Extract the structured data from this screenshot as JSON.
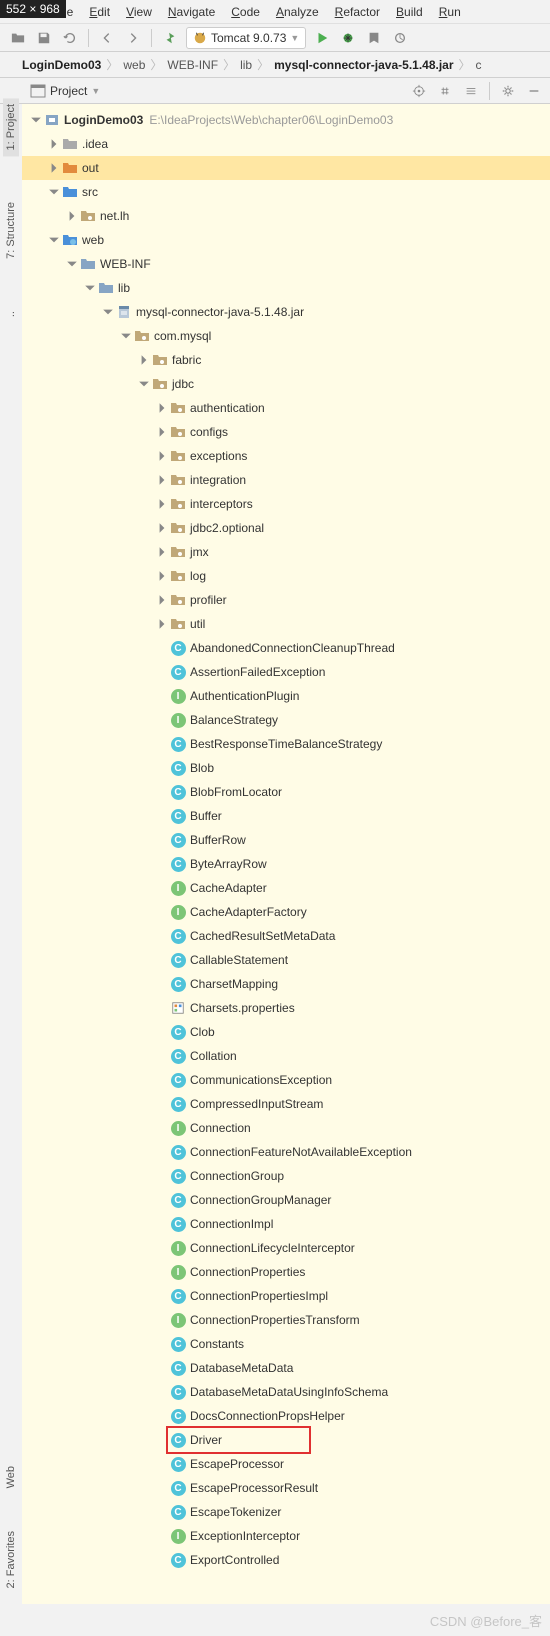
{
  "dimBadge": "552 × 968",
  "menu": [
    "File",
    "Edit",
    "View",
    "Navigate",
    "Code",
    "Analyze",
    "Refactor",
    "Build",
    "Run"
  ],
  "runConfig": "Tomcat 9.0.73",
  "breadcrumbs": [
    "LoginDemo03",
    "web",
    "WEB-INF",
    "lib",
    "mysql-connector-java-5.1.48.jar",
    "c"
  ],
  "projectLabel": "Project",
  "sideTabs": {
    "project": "1: Project",
    "structure": "7: Structure",
    "web": "Web",
    "favorites": "2: Favorites"
  },
  "tree": [
    {
      "d": 0,
      "a": "down",
      "t": "module",
      "l": "LoginDemo03",
      "p": "E:\\IdeaProjects\\Web\\chapter06\\LoginDemo03",
      "bold": true
    },
    {
      "d": 1,
      "a": "right",
      "t": "folder-grey",
      "l": ".idea"
    },
    {
      "d": 1,
      "a": "right",
      "t": "folder-orange",
      "l": "out",
      "sel": true
    },
    {
      "d": 1,
      "a": "down",
      "t": "folder-blue",
      "l": "src"
    },
    {
      "d": 2,
      "a": "right",
      "t": "pkg",
      "l": "net.lh"
    },
    {
      "d": 1,
      "a": "down",
      "t": "web",
      "l": "web"
    },
    {
      "d": 2,
      "a": "down",
      "t": "folder",
      "l": "WEB-INF"
    },
    {
      "d": 3,
      "a": "down",
      "t": "folder",
      "l": "lib"
    },
    {
      "d": 4,
      "a": "down",
      "t": "jar",
      "l": "mysql-connector-java-5.1.48.jar"
    },
    {
      "d": 5,
      "a": "down",
      "t": "pkg",
      "l": "com.mysql"
    },
    {
      "d": 6,
      "a": "right",
      "t": "pkg",
      "l": "fabric"
    },
    {
      "d": 6,
      "a": "down",
      "t": "pkg",
      "l": "jdbc"
    },
    {
      "d": 7,
      "a": "right",
      "t": "pkg",
      "l": "authentication"
    },
    {
      "d": 7,
      "a": "right",
      "t": "pkg",
      "l": "configs"
    },
    {
      "d": 7,
      "a": "right",
      "t": "pkg",
      "l": "exceptions"
    },
    {
      "d": 7,
      "a": "right",
      "t": "pkg",
      "l": "integration"
    },
    {
      "d": 7,
      "a": "right",
      "t": "pkg",
      "l": "interceptors"
    },
    {
      "d": 7,
      "a": "right",
      "t": "pkg",
      "l": "jdbc2.optional"
    },
    {
      "d": 7,
      "a": "right",
      "t": "pkg",
      "l": "jmx"
    },
    {
      "d": 7,
      "a": "right",
      "t": "pkg",
      "l": "log"
    },
    {
      "d": 7,
      "a": "right",
      "t": "pkg",
      "l": "profiler"
    },
    {
      "d": 7,
      "a": "right",
      "t": "pkg",
      "l": "util"
    },
    {
      "d": 7,
      "a": "",
      "t": "class",
      "l": "AbandonedConnectionCleanupThread"
    },
    {
      "d": 7,
      "a": "",
      "t": "class",
      "l": "AssertionFailedException"
    },
    {
      "d": 7,
      "a": "",
      "t": "intf",
      "l": "AuthenticationPlugin"
    },
    {
      "d": 7,
      "a": "",
      "t": "intf",
      "l": "BalanceStrategy"
    },
    {
      "d": 7,
      "a": "",
      "t": "class",
      "l": "BestResponseTimeBalanceStrategy"
    },
    {
      "d": 7,
      "a": "",
      "t": "class",
      "l": "Blob"
    },
    {
      "d": 7,
      "a": "",
      "t": "class",
      "l": "BlobFromLocator"
    },
    {
      "d": 7,
      "a": "",
      "t": "class",
      "l": "Buffer"
    },
    {
      "d": 7,
      "a": "",
      "t": "class",
      "l": "BufferRow"
    },
    {
      "d": 7,
      "a": "",
      "t": "class",
      "l": "ByteArrayRow"
    },
    {
      "d": 7,
      "a": "",
      "t": "intf",
      "l": "CacheAdapter"
    },
    {
      "d": 7,
      "a": "",
      "t": "intf",
      "l": "CacheAdapterFactory"
    },
    {
      "d": 7,
      "a": "",
      "t": "class",
      "l": "CachedResultSetMetaData"
    },
    {
      "d": 7,
      "a": "",
      "t": "class",
      "l": "CallableStatement"
    },
    {
      "d": 7,
      "a": "",
      "t": "class",
      "l": "CharsetMapping"
    },
    {
      "d": 7,
      "a": "",
      "t": "prop",
      "l": "Charsets.properties"
    },
    {
      "d": 7,
      "a": "",
      "t": "class",
      "l": "Clob"
    },
    {
      "d": 7,
      "a": "",
      "t": "class",
      "l": "Collation"
    },
    {
      "d": 7,
      "a": "",
      "t": "class",
      "l": "CommunicationsException"
    },
    {
      "d": 7,
      "a": "",
      "t": "class",
      "l": "CompressedInputStream"
    },
    {
      "d": 7,
      "a": "",
      "t": "intf",
      "l": "Connection"
    },
    {
      "d": 7,
      "a": "",
      "t": "class",
      "l": "ConnectionFeatureNotAvailableException"
    },
    {
      "d": 7,
      "a": "",
      "t": "class",
      "l": "ConnectionGroup"
    },
    {
      "d": 7,
      "a": "",
      "t": "class",
      "l": "ConnectionGroupManager"
    },
    {
      "d": 7,
      "a": "",
      "t": "class",
      "l": "ConnectionImpl"
    },
    {
      "d": 7,
      "a": "",
      "t": "intf",
      "l": "ConnectionLifecycleInterceptor"
    },
    {
      "d": 7,
      "a": "",
      "t": "intf",
      "l": "ConnectionProperties"
    },
    {
      "d": 7,
      "a": "",
      "t": "class",
      "l": "ConnectionPropertiesImpl"
    },
    {
      "d": 7,
      "a": "",
      "t": "intf",
      "l": "ConnectionPropertiesTransform"
    },
    {
      "d": 7,
      "a": "",
      "t": "class",
      "l": "Constants"
    },
    {
      "d": 7,
      "a": "",
      "t": "class",
      "l": "DatabaseMetaData"
    },
    {
      "d": 7,
      "a": "",
      "t": "class",
      "l": "DatabaseMetaDataUsingInfoSchema"
    },
    {
      "d": 7,
      "a": "",
      "t": "class",
      "l": "DocsConnectionPropsHelper"
    },
    {
      "d": 7,
      "a": "",
      "t": "class",
      "l": "Driver",
      "hl": true
    },
    {
      "d": 7,
      "a": "",
      "t": "class",
      "l": "EscapeProcessor"
    },
    {
      "d": 7,
      "a": "",
      "t": "class",
      "l": "EscapeProcessorResult"
    },
    {
      "d": 7,
      "a": "",
      "t": "class",
      "l": "EscapeTokenizer"
    },
    {
      "d": 7,
      "a": "",
      "t": "intf",
      "l": "ExceptionInterceptor"
    },
    {
      "d": 7,
      "a": "",
      "t": "class",
      "l": "ExportControlled"
    }
  ],
  "watermark": "CSDN @Before_客"
}
